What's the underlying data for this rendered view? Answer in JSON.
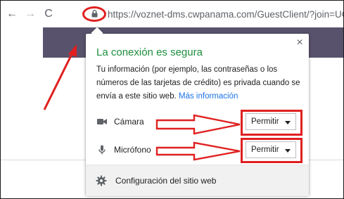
{
  "browser": {
    "back_glyph": "←",
    "forward_glyph": "→",
    "reload_glyph": "C",
    "lock_icon": "lock-icon",
    "url": "https://voznet-dms.cwpanama.com/GuestClient/?join=UG"
  },
  "popup": {
    "title": "La conexión es segura",
    "description": "Tu información (por ejemplo, las contraseñas o los números de las tarjetas de crédito) es privada cuando se envía a este sitio web.",
    "more_link": "Más información",
    "close_glyph": "×",
    "permissions": [
      {
        "icon": "camera-icon",
        "label": "Cámara",
        "value": "Permitir"
      },
      {
        "icon": "microphone-icon",
        "label": "Micrófono",
        "value": "Permitir"
      }
    ],
    "footer_icon": "gear-icon",
    "footer_label": "Configuración del sitio web"
  },
  "colors": {
    "annotation": "#e02020",
    "secure_title": "#1e8e3e",
    "link": "#1a73e8",
    "page_strip": "#59526c"
  }
}
